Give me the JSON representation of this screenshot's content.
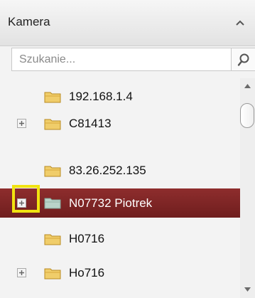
{
  "panel": {
    "title": "Kamera",
    "collapse_icon": "chevron-up-icon"
  },
  "search": {
    "placeholder": "Szukanie...",
    "value": "",
    "button_icon": "search-icon"
  },
  "tree": {
    "items": [
      {
        "label": "192.168.1.4",
        "expandable": false,
        "selected": false,
        "icon": "folder-icon"
      },
      {
        "label": "C81413",
        "expandable": true,
        "selected": false,
        "icon": "folder-icon"
      },
      {
        "label": "83.26.252.135",
        "expandable": false,
        "selected": false,
        "icon": "folder-icon"
      },
      {
        "label": "N07732 Piotrek",
        "expandable": true,
        "selected": true,
        "icon": "folder-icon",
        "highlighted_expander": true
      },
      {
        "label": "H0716",
        "expandable": false,
        "selected": false,
        "icon": "folder-icon"
      },
      {
        "label": "Ho716",
        "expandable": true,
        "selected": false,
        "icon": "folder-icon"
      }
    ]
  },
  "colors": {
    "selected_row": "#7f2525",
    "highlight": "#f1e310",
    "folder": "#f0cd6a"
  }
}
